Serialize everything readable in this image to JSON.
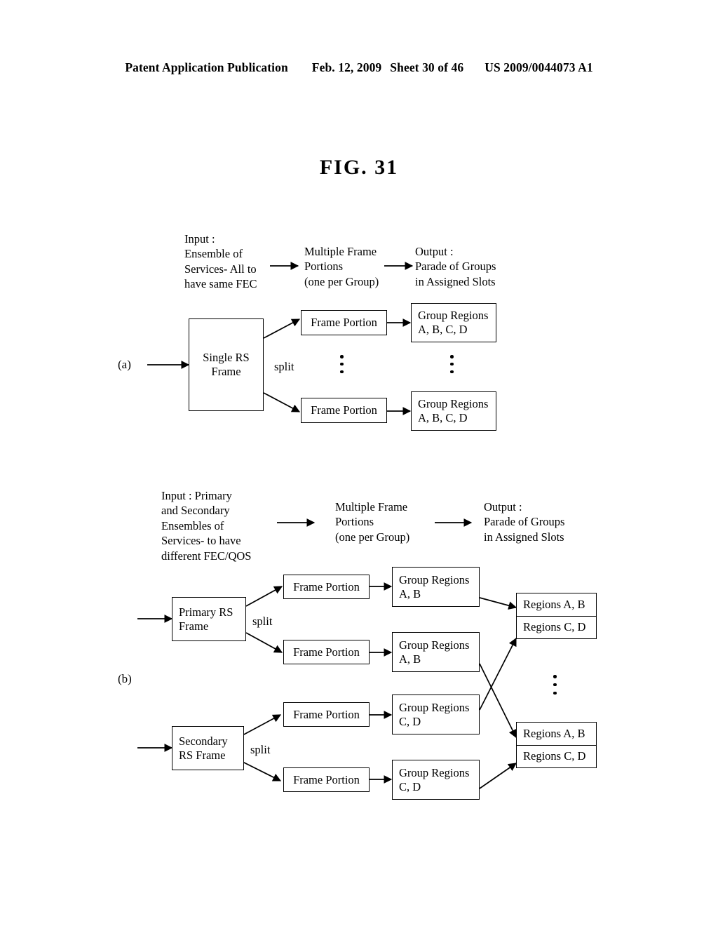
{
  "header": {
    "publication": "Patent Application Publication",
    "date": "Feb. 12, 2009",
    "sheet": "Sheet 30 of 46",
    "number": "US 2009/0044073 A1"
  },
  "figure": {
    "title": "FIG. 31"
  },
  "section_a": {
    "label": "(a)",
    "captions": {
      "input": "Input :\nEnsemble of\nServices- All to\nhave same FEC",
      "middle": "Multiple Frame\nPortions\n(one per Group)",
      "output": "Output :\nParade of Groups\nin Assigned Slots"
    },
    "source_box": "Single RS\nFrame",
    "split_label": "split",
    "frame_portion_top": "Frame Portion",
    "frame_portion_bottom": "Frame Portion",
    "group_regions_top": "Group Regions\nA, B, C, D",
    "group_regions_bottom": "Group Regions\nA, B, C, D"
  },
  "section_b": {
    "label": "(b)",
    "captions": {
      "input": "Input : Primary\nand Secondary\nEnsembles of\nServices- to have\ndifferent FEC/QOS",
      "middle": "Multiple Frame\nPortions\n(one per Group)",
      "output": "Output :\nParade of Groups\nin Assigned Slots"
    },
    "primary_box": "Primary RS\nFrame",
    "secondary_box": "Secondary\nRS Frame",
    "split_label_primary": "split",
    "split_label_secondary": "split",
    "frame_portions": [
      "Frame Portion",
      "Frame Portion",
      "Frame Portion",
      "Frame Portion"
    ],
    "group_regions": [
      "Group Regions\nA, B",
      "Group Regions\nA, B",
      "Group Regions\nC, D",
      "Group Regions\nC, D"
    ],
    "parade_top": {
      "cell_1": "Regions A, B",
      "cell_2": "Regions C, D"
    },
    "parade_bottom": {
      "cell_1": "Regions A, B",
      "cell_2": "Regions C, D"
    }
  },
  "colors": {
    "ink": "#000000",
    "paper": "#ffffff"
  }
}
